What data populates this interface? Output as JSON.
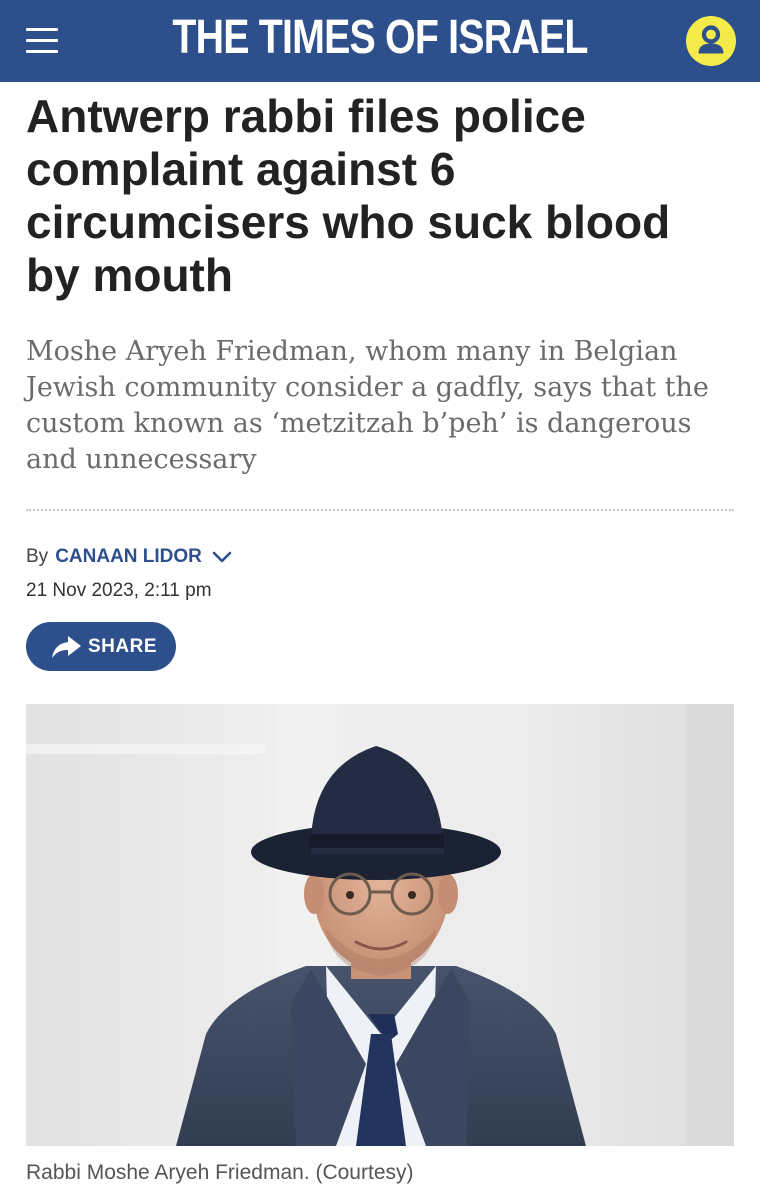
{
  "header": {
    "brand": "THE TIMES OF ISRAEL",
    "menu_icon": "hamburger-menu-icon",
    "user_icon": "user-account-icon",
    "colors": {
      "bar": "#2d4f8b",
      "user_button": "#f4ea4a"
    }
  },
  "article": {
    "headline": "Antwerp rabbi files police complaint against 6 circumcisers who suck blood by mouth",
    "subhead": "Moshe Aryeh Friedman, whom many in Belgian Jewish community consider a gadfly, says that the custom known as ‘metzitzah b’peh’ is dangerous and unnecessary",
    "byline_prefix": "By",
    "author": "CANAAN LIDOR",
    "date": "21 Nov 2023, 2:11 pm",
    "share_label": "SHARE",
    "image_caption": "Rabbi Moshe Aryeh Friedman. (Courtesy)"
  }
}
